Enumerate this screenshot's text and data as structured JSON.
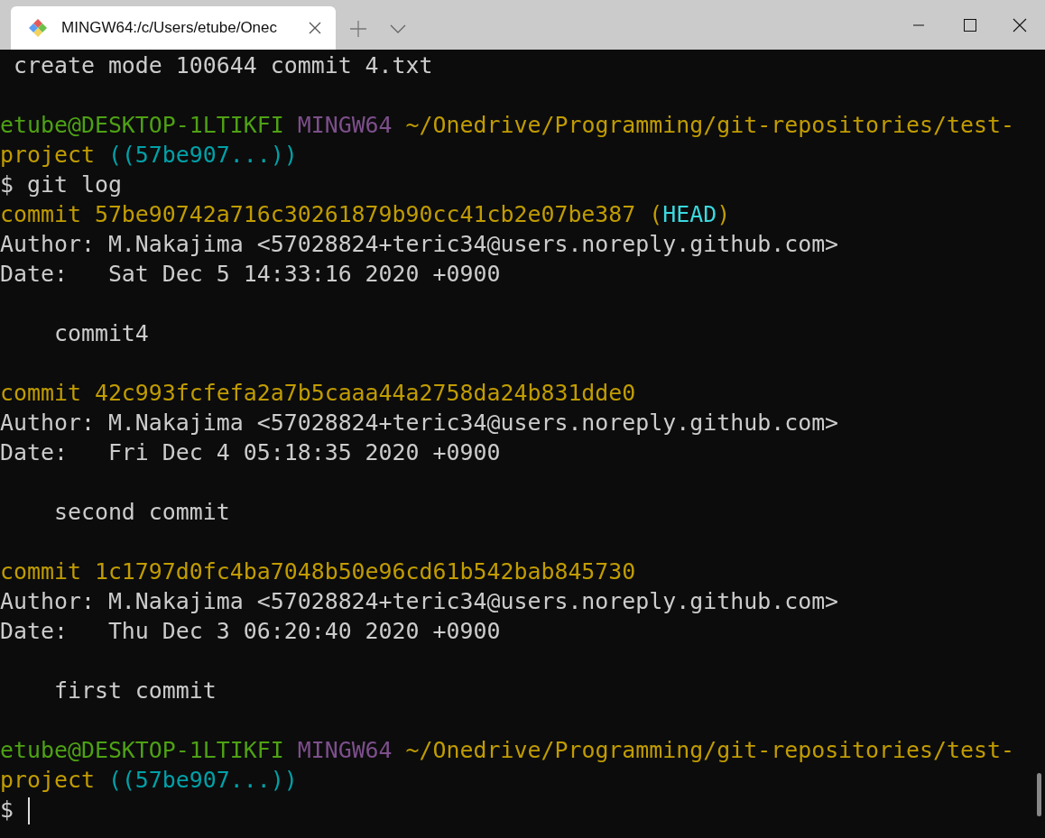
{
  "window": {
    "tab_title": "MINGW64:/c/Users/etube/Onec"
  },
  "terminal": {
    "lines": [
      {
        "kind": "text",
        "segments": [
          {
            "kind": "plain",
            "text": " create mode 100644 commit 4.txt"
          }
        ]
      },
      {
        "kind": "blank"
      },
      {
        "kind": "text",
        "segments": [
          {
            "kind": "user",
            "text": "etube@DESKTOP-1LTIKFI"
          },
          {
            "kind": "system",
            "text": " MINGW64"
          },
          {
            "kind": "path",
            "text": " ~/Onedrive/Programming/git-repositories/test-"
          }
        ]
      },
      {
        "kind": "text",
        "segments": [
          {
            "kind": "path",
            "text": "project"
          },
          {
            "kind": "branch",
            "text": " ((57be907...))"
          }
        ]
      },
      {
        "kind": "text",
        "segments": [
          {
            "kind": "plain",
            "text": "$ git log"
          }
        ]
      },
      {
        "kind": "text",
        "segments": [
          {
            "kind": "path",
            "text": "commit 57be90742a716c30261879b90cc41cb2e07be387 ("
          },
          {
            "kind": "head",
            "text": "HEAD"
          },
          {
            "kind": "path",
            "text": ")"
          }
        ]
      },
      {
        "kind": "text",
        "segments": [
          {
            "kind": "plain",
            "text": "Author: M.Nakajima <57028824+teric34@users.noreply.github.com>"
          }
        ]
      },
      {
        "kind": "text",
        "segments": [
          {
            "kind": "plain",
            "text": "Date:   Sat Dec 5 14:33:16 2020 +0900"
          }
        ]
      },
      {
        "kind": "blank"
      },
      {
        "kind": "text",
        "segments": [
          {
            "kind": "plain",
            "text": "    commit4"
          }
        ]
      },
      {
        "kind": "blank"
      },
      {
        "kind": "text",
        "segments": [
          {
            "kind": "path",
            "text": "commit 42c993fcfefa2a7b5caaa44a2758da24b831dde0"
          }
        ]
      },
      {
        "kind": "text",
        "segments": [
          {
            "kind": "plain",
            "text": "Author: M.Nakajima <57028824+teric34@users.noreply.github.com>"
          }
        ]
      },
      {
        "kind": "text",
        "segments": [
          {
            "kind": "plain",
            "text": "Date:   Fri Dec 4 05:18:35 2020 +0900"
          }
        ]
      },
      {
        "kind": "blank"
      },
      {
        "kind": "text",
        "segments": [
          {
            "kind": "plain",
            "text": "    second commit"
          }
        ]
      },
      {
        "kind": "blank"
      },
      {
        "kind": "text",
        "segments": [
          {
            "kind": "path",
            "text": "commit 1c1797d0fc4ba7048b50e96cd61b542bab845730"
          }
        ]
      },
      {
        "kind": "text",
        "segments": [
          {
            "kind": "plain",
            "text": "Author: M.Nakajima <57028824+teric34@users.noreply.github.com>"
          }
        ]
      },
      {
        "kind": "text",
        "segments": [
          {
            "kind": "plain",
            "text": "Date:   Thu Dec 3 06:20:40 2020 +0900"
          }
        ]
      },
      {
        "kind": "blank"
      },
      {
        "kind": "text",
        "segments": [
          {
            "kind": "plain",
            "text": "    first commit"
          }
        ]
      },
      {
        "kind": "blank"
      },
      {
        "kind": "text",
        "segments": [
          {
            "kind": "user",
            "text": "etube@DESKTOP-1LTIKFI"
          },
          {
            "kind": "system",
            "text": " MINGW64"
          },
          {
            "kind": "path",
            "text": " ~/Onedrive/Programming/git-repositories/test-"
          }
        ]
      },
      {
        "kind": "text",
        "segments": [
          {
            "kind": "path",
            "text": "project"
          },
          {
            "kind": "branch",
            "text": " ((57be907...))"
          }
        ]
      },
      {
        "kind": "prompt",
        "segments": [
          {
            "kind": "plain",
            "text": "$"
          }
        ]
      }
    ]
  }
}
